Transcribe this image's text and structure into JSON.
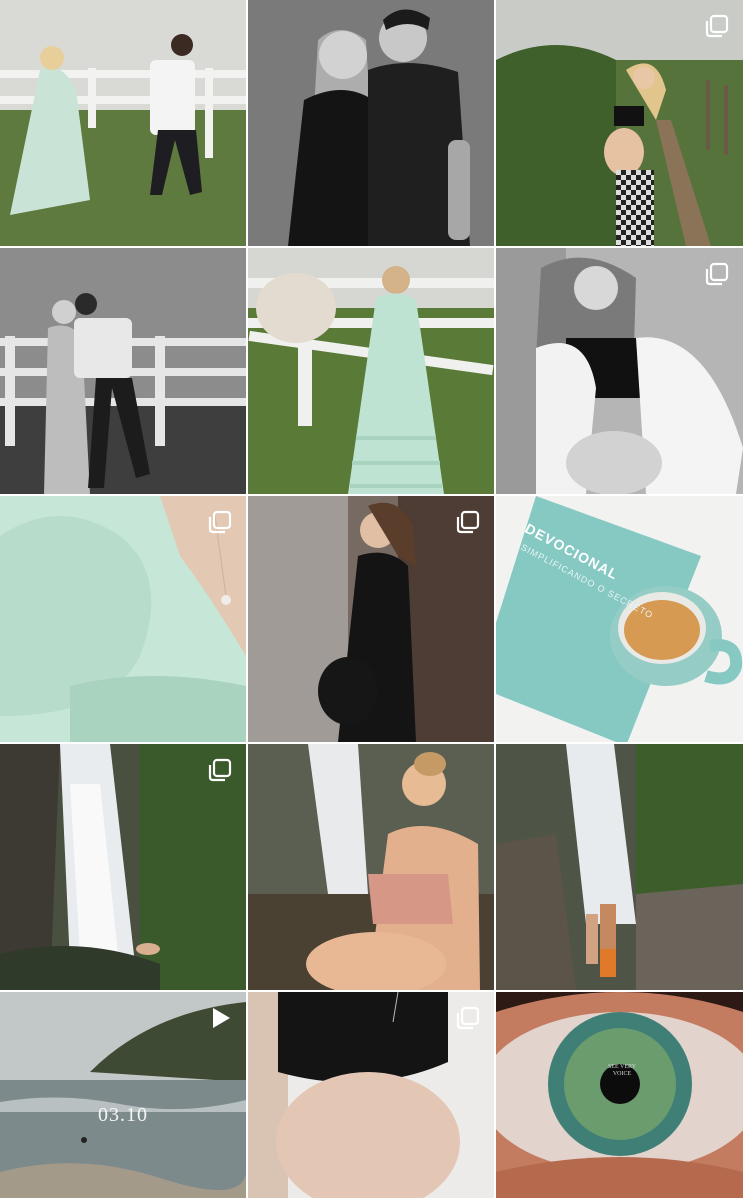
{
  "grid": {
    "posts": [
      {
        "id": "p1",
        "badge": "none"
      },
      {
        "id": "p2",
        "badge": "none"
      },
      {
        "id": "p3",
        "badge": "carousel"
      },
      {
        "id": "p4",
        "badge": "none"
      },
      {
        "id": "p5",
        "badge": "none"
      },
      {
        "id": "p6",
        "badge": "carousel"
      },
      {
        "id": "p7",
        "badge": "carousel"
      },
      {
        "id": "p8",
        "badge": "carousel"
      },
      {
        "id": "p9",
        "badge": "none"
      },
      {
        "id": "p10",
        "badge": "carousel"
      },
      {
        "id": "p11",
        "badge": "none"
      },
      {
        "id": "p12",
        "badge": "none"
      },
      {
        "id": "p13",
        "badge": "reel"
      },
      {
        "id": "p14",
        "badge": "carousel"
      },
      {
        "id": "p15",
        "badge": "none"
      }
    ]
  },
  "overlays": {
    "beach_date": "03.10",
    "book_title": "DEVOCIONAL",
    "book_subtitle": "SIMPLIFICANDO O SECRETO",
    "eye_text": "SEE VERY VOICE"
  },
  "icons": {
    "carousel": "carousel-icon",
    "reel": "reel-play-icon"
  },
  "colors": {
    "badge": "#ffffff",
    "book": "#86c9c3",
    "mint_dress": "#bfe3d3"
  }
}
